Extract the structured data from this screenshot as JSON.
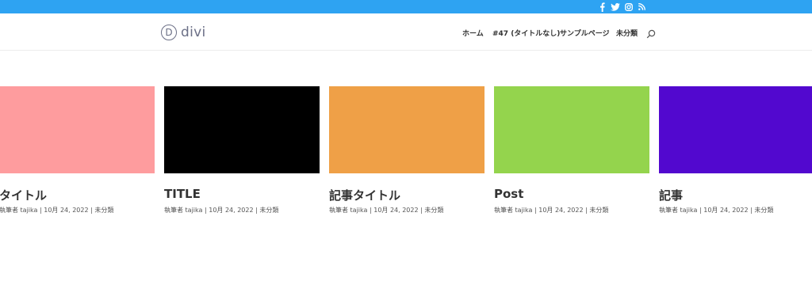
{
  "topbar": {
    "color": "#2ea3f2",
    "social_icons": [
      "facebook-icon",
      "twitter-icon",
      "instagram-icon",
      "rss-icon"
    ]
  },
  "header": {
    "logo": {
      "mark": "D",
      "text": "divi"
    },
    "nav": [
      "ホーム",
      "#47 (タイトルなし)",
      "サンプルページ",
      "未分類"
    ],
    "search_icon": "search-icon"
  },
  "posts": [
    {
      "title": "タイトル",
      "color": "#fe9c9e",
      "meta": {
        "prefix": "執筆者",
        "author": "tajika",
        "date": "10月 24, 2022",
        "category": "未分類"
      }
    },
    {
      "title": "TITLE",
      "color": "#000000",
      "meta": {
        "prefix": "執筆者",
        "author": "tajika",
        "date": "10月 24, 2022",
        "category": "未分類"
      }
    },
    {
      "title": "記事タイトル",
      "color": "#efa047",
      "meta": {
        "prefix": "執筆者",
        "author": "tajika",
        "date": "10月 24, 2022",
        "category": "未分類"
      }
    },
    {
      "title": "Post",
      "color": "#94d44d",
      "meta": {
        "prefix": "執筆者",
        "author": "tajika",
        "date": "10月 24, 2022",
        "category": "未分類"
      }
    },
    {
      "title": "記事",
      "color": "#5208cf",
      "meta": {
        "prefix": "執筆者",
        "author": "tajika",
        "date": "10月 24, 2022",
        "category": "未分類"
      }
    }
  ]
}
